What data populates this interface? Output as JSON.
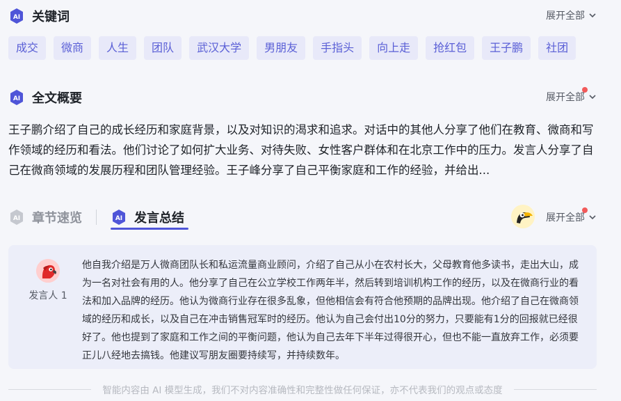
{
  "keywords": {
    "title": "关键词",
    "expand_label": "展开全部",
    "tags": [
      "成交",
      "微商",
      "人生",
      "团队",
      "武汉大学",
      "男朋友",
      "手指头",
      "向上走",
      "抢红包",
      "王子鹏",
      "社团"
    ]
  },
  "overview": {
    "title": "全文概要",
    "expand_label": "展开全部",
    "text": "王子鹏介绍了自己的成长经历和家庭背景，以及对知识的渴求和追求。对话中的其他人分享了他们在教育、微商和写作领域的经历和看法。他们讨论了如何扩大业务、对待失败、女性客户群体和在北京工作中的压力。发言人分享了自己在微商领域的发展历程和团队管理经验。王子峰分享了自己平衡家庭和工作的经验，并给出..."
  },
  "tabs": {
    "chapter_label": "章节速览",
    "speech_label": "发言总结",
    "expand_label": "展开全部"
  },
  "speech_card": {
    "speaker_name": "发言人 1",
    "text": "他自我介绍是万人微商团队长和私运流量商业顾问，介绍了自己从小在农村长大，父母教育他多读书，走出大山，成为一名对社会有用的人。他分享了自己在公立学校工作两年半，然后转到培训机构工作的经历，以及在微商行业的看法和加入品牌的经历。他认为微商行业存在很多乱象，但他相信会有符合他预期的品牌出现。他介绍了自己在微商领域的经历和成长，以及自己在冲击销售冠军时的经历。他认为自己会付出10分的努力，只要能有1分的回报就已经很好了。他也提到了家庭和工作之间的平衡问题，他认为自己去年下半年过得很开心，但也不能一直放弃工作，必须要正儿八经地去搞钱。他建议写朋友圈要持续写，并持续数年。"
  },
  "footer": {
    "disclaimer": "智能内容由 AI 模型生成，我们不对内容准确性和完整性做任何保证，亦不代表我们的观点或态度"
  },
  "colors": {
    "accent": "#4f55d8",
    "tag_bg": "#e8e9f9",
    "tag_text": "#5a5fd6",
    "card_bg": "#eceef9",
    "notice_dot": "#f25a5a"
  },
  "icons": {
    "section": "ai-badge-icon",
    "expand": "chevron-down-icon",
    "assistant": "toucan-avatar-icon",
    "speaker": "parrot-avatar-icon"
  }
}
